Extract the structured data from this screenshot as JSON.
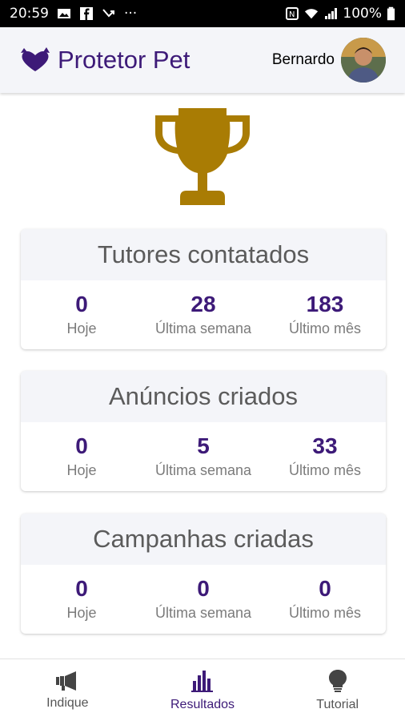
{
  "statusbar": {
    "time": "20:59",
    "dots": "···",
    "battery": "100%"
  },
  "header": {
    "title": "Protetor Pet",
    "user_name": "Bernardo"
  },
  "cards": [
    {
      "title": "Tutores contatados",
      "stats": [
        {
          "value": "0",
          "label": "Hoje"
        },
        {
          "value": "28",
          "label": "Última semana"
        },
        {
          "value": "183",
          "label": "Último mês"
        }
      ]
    },
    {
      "title": "Anúncios criados",
      "stats": [
        {
          "value": "0",
          "label": "Hoje"
        },
        {
          "value": "5",
          "label": "Última semana"
        },
        {
          "value": "33",
          "label": "Último mês"
        }
      ]
    },
    {
      "title": "Campanhas criadas",
      "stats": [
        {
          "value": "0",
          "label": "Hoje"
        },
        {
          "value": "0",
          "label": "Última semana"
        },
        {
          "value": "0",
          "label": "Último mês"
        }
      ]
    }
  ],
  "nav": {
    "items": [
      {
        "label": "Indique",
        "icon": "megaphone-icon"
      },
      {
        "label": "Resultados",
        "icon": "bar-chart-icon",
        "active": true
      },
      {
        "label": "Tutorial",
        "icon": "lightbulb-icon"
      }
    ]
  },
  "colors": {
    "brand": "#3d1a78",
    "trophy": "#a97c04",
    "header_bg": "#f4f5f9"
  }
}
